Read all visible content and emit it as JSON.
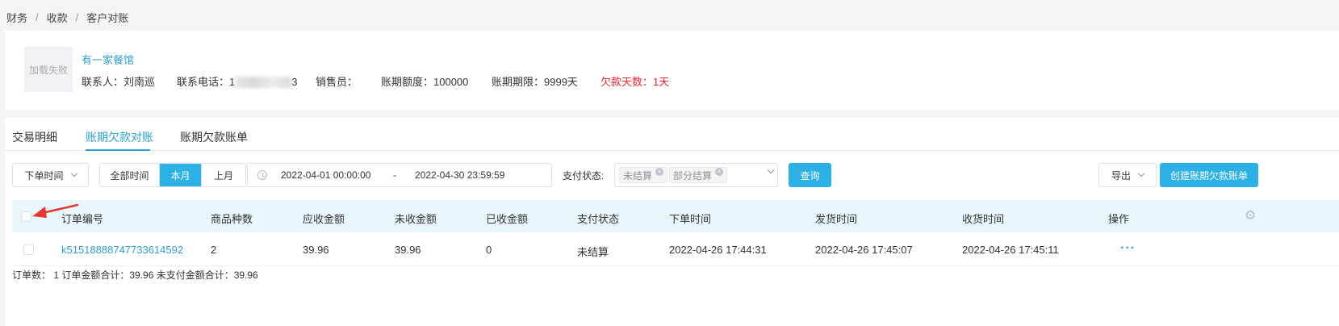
{
  "breadcrumb": [
    "财务",
    "收款",
    "客户对账"
  ],
  "breadcrumb_sep": "/",
  "customer": {
    "image_placeholder": "加载失败",
    "name": "有一家餐馆",
    "contact_label": "联系人：刘南巡",
    "phone_prefix": "联系电话：1",
    "phone_suffix": "3",
    "sales_label": "销售员：",
    "credit_limit": "账期额度：100000",
    "credit_period": "账期期限：9999天",
    "overdue_days": "欠款天数：1天"
  },
  "tabs": [
    {
      "label": "交易明细",
      "active": false
    },
    {
      "label": "账期欠款对账",
      "active": true
    },
    {
      "label": "账期欠款账单",
      "active": false
    }
  ],
  "filters": {
    "time_type": "下单时间",
    "ranges": [
      {
        "label": "全部时间",
        "active": false
      },
      {
        "label": "本月",
        "active": true
      },
      {
        "label": "上月",
        "active": false
      }
    ],
    "date_start": "2022-04-01 00:00:00",
    "date_sep": "-",
    "date_end": "2022-04-30 23:59:59",
    "pay_status_label": "支付状态:",
    "pay_status_tags": [
      "未结算",
      "部分结算"
    ],
    "query_button": "查询",
    "export_button": "导出",
    "create_button": "创建账期欠款账单"
  },
  "table": {
    "columns": [
      "订单编号",
      "商品种数",
      "应收金额",
      "未收金额",
      "已收金额",
      "支付状态",
      "下单时间",
      "发货时间",
      "收货时间",
      "操作"
    ],
    "rows": [
      {
        "order_no": "k5151888874773361459​2",
        "item_count": "2",
        "receivable": "39.96",
        "unreceived": "39.96",
        "received": "0",
        "pay_status": "未结算",
        "order_time": "2022-04-26 17:44:31",
        "ship_time": "2022-04-26 17:45:07",
        "receive_time": "2022-04-26 17:45:11",
        "actions": "···"
      }
    ],
    "summary": "订单数： 1 订单金额合计：39.96 未支付金额合计：39.96"
  },
  "colors": {
    "accent": "#2bb1e5",
    "link": "#2b9fd6",
    "warning": "#f5222d",
    "header_bg": "#e9f6fb",
    "annotation_arrow": "#e8372c"
  }
}
